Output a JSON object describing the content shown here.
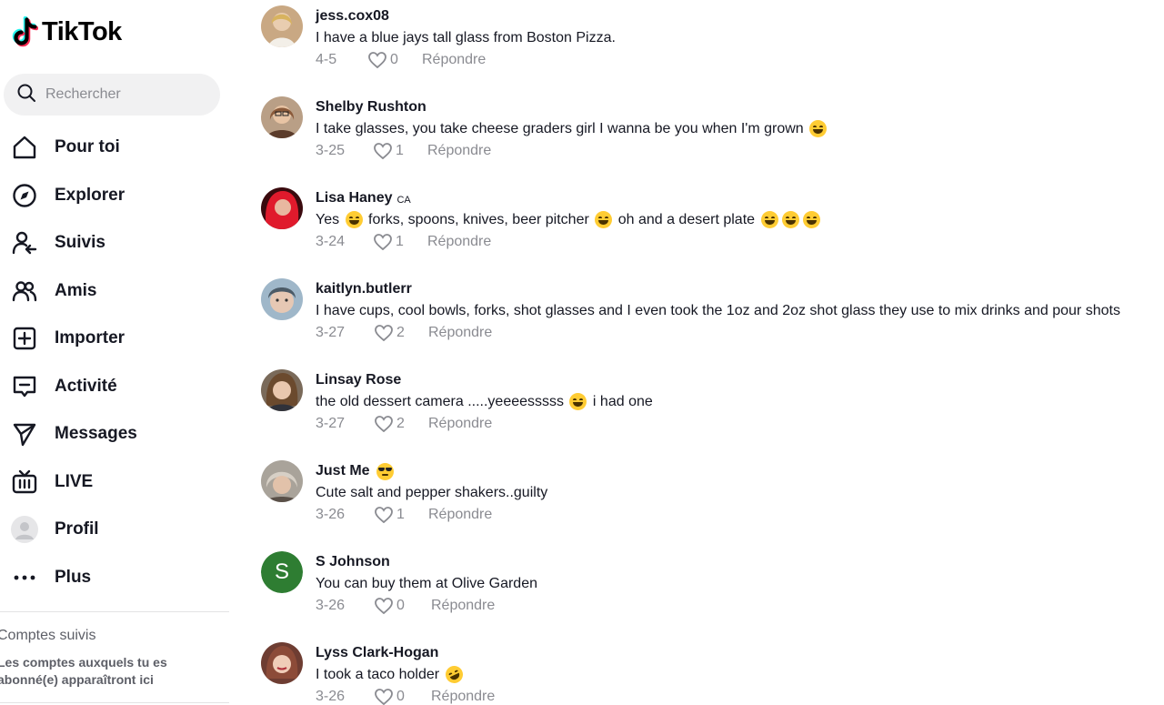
{
  "app": {
    "name": "TikTok"
  },
  "search": {
    "placeholder": "Rechercher"
  },
  "nav": {
    "items": [
      {
        "label": "Pour toi"
      },
      {
        "label": "Explorer"
      },
      {
        "label": "Suivis"
      },
      {
        "label": "Amis"
      },
      {
        "label": "Importer"
      },
      {
        "label": "Activité"
      },
      {
        "label": "Messages"
      },
      {
        "label": "LIVE"
      },
      {
        "label": "Profil"
      },
      {
        "label": "Plus"
      }
    ]
  },
  "following": {
    "title": "Comptes suivis",
    "description": "Les comptes auxquels tu es abonné(e) apparaîtront ici"
  },
  "reply_label": "Répondre",
  "comments": [
    {
      "user": "jess.cox08",
      "badge": "",
      "text": "I have a blue jays tall glass from Boston Pizza.",
      "date": "4-5",
      "likes": "0"
    },
    {
      "user": "Shelby Rushton",
      "badge": "",
      "text": "I take glasses, you take cheese graders girl I wanna be you when I'm grown",
      "date": "3-25",
      "likes": "1"
    },
    {
      "user": "Lisa Haney",
      "badge": "CA",
      "text_parts": [
        "Yes",
        "forks, spoons, knives, beer pitcher",
        "oh and a desert plate"
      ],
      "date": "3-24",
      "likes": "1"
    },
    {
      "user": "kaitlyn.butlerr",
      "badge": "",
      "text": "I have cups, cool bowls, forks, shot glasses and I even took the 1oz and 2oz shot glass they use to mix drinks and pour shots",
      "date": "3-27",
      "likes": "2"
    },
    {
      "user": "Linsay Rose",
      "badge": "",
      "text_parts": [
        "the old dessert camera .....yeeeesssss",
        "i had one"
      ],
      "date": "3-27",
      "likes": "2"
    },
    {
      "user": "Just Me",
      "badge": "",
      "text": "Cute salt and pepper shakers..guilty",
      "date": "3-26",
      "likes": "1"
    },
    {
      "user": "S Johnson",
      "avatar_letter": "S",
      "badge": "",
      "text": "You can buy them at Olive Garden",
      "date": "3-26",
      "likes": "0"
    },
    {
      "user": "Lyss Clark-Hogan",
      "badge": "",
      "text": "I took a taco holder",
      "date": "3-26",
      "likes": "0"
    }
  ],
  "colors": {
    "text": "#161823",
    "muted": "#8a8b91",
    "search_bg": "#f1f1f2",
    "avatar_green": "#2e7d32",
    "logo_cyan": "#25f4ee",
    "logo_red": "#fe2c55"
  }
}
